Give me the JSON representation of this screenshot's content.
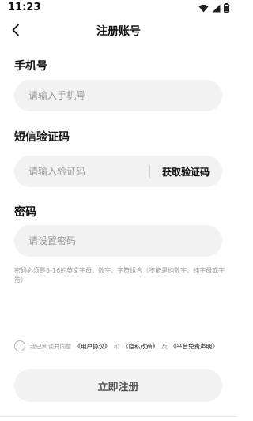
{
  "status_bar": {
    "time": "11:23",
    "icons": [
      "wifi-icon",
      "signal-icon",
      "battery-icon"
    ]
  },
  "header": {
    "title": "注册账号",
    "back_icon": "chevron-left-icon"
  },
  "form": {
    "phone": {
      "label": "手机号",
      "placeholder": "请输入手机号",
      "value": ""
    },
    "code": {
      "label": "短信验证码",
      "placeholder": "请输入验证码",
      "value": "",
      "get_code_label": "获取验证码"
    },
    "password": {
      "label": "密码",
      "placeholder": "请设置密码",
      "value": "",
      "hint": "密码必须是8-16的英文字母、数字、字符组合（不能是纯数字、纯字母或字符）"
    }
  },
  "agreement": {
    "checked": false,
    "prefix": "我已阅读并同意",
    "user_agreement": "《用户协议》",
    "and": "和",
    "privacy_policy": "《隐私政策》",
    "and2": "及",
    "disclaimer": "《平台免责声明》"
  },
  "submit": {
    "label": "立即注册"
  },
  "colors": {
    "background": "#ffffff",
    "input_bg": "#f2f2f2",
    "placeholder": "#9a9a9a",
    "text": "#111111"
  }
}
